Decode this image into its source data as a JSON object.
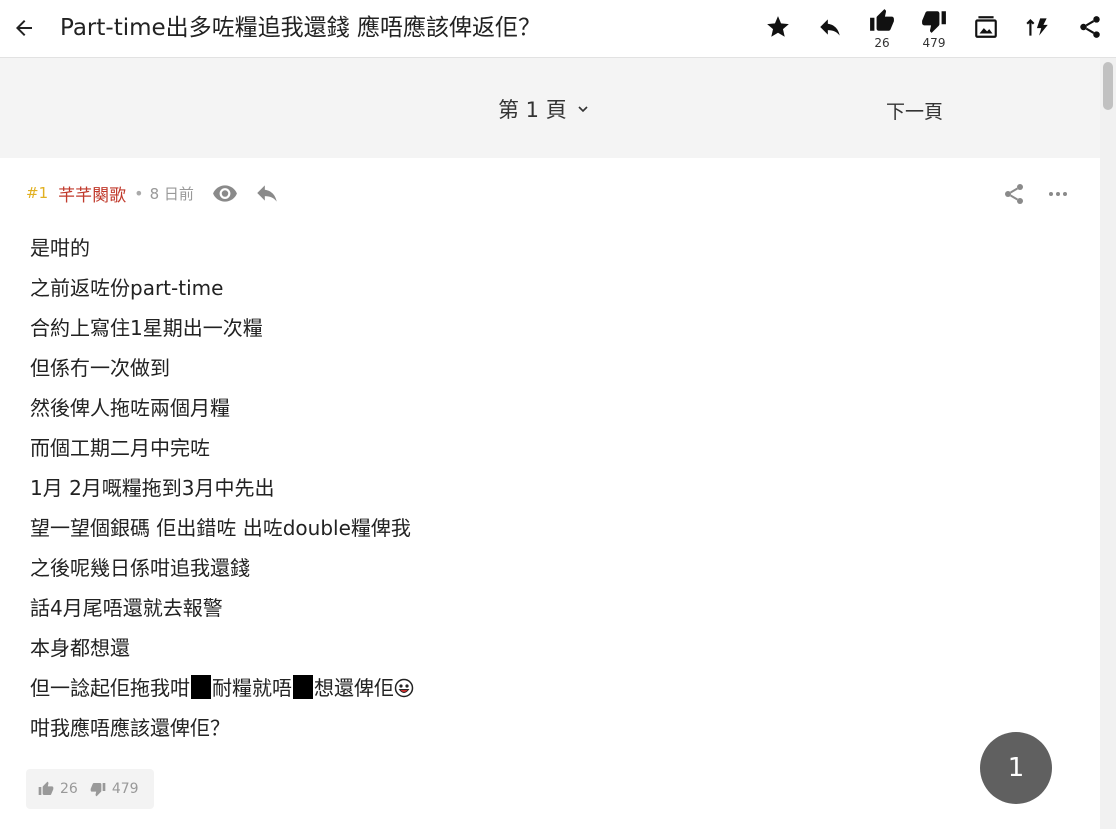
{
  "header": {
    "title": "Part-time出多咗糧追我還錢 應唔應該俾返佢？",
    "like_count": "26",
    "dislike_count": "479"
  },
  "pager": {
    "page_label": "第 1 頁",
    "next_label": "下一頁"
  },
  "post": {
    "number": "#1",
    "author": "芊芊闋歌",
    "separator": "•",
    "time": "8 日前",
    "lines": [
      "是咁的",
      "之前返咗份part-time",
      "合約上寫住1星期出一次糧",
      "但係冇一次做到",
      "然後俾人拖咗兩個月糧",
      "而個工期二月中完咗",
      "1月 2月嘅糧拖到3月中先出",
      "望一望個銀碼 佢出錯咗 出咗double糧俾我",
      "之後呢幾日係咁追我還錢",
      "話4月尾唔還就去報警",
      "本身都想還"
    ],
    "line_12_a": "但一諗起佢拖我咁",
    "line_12_b": "耐糧就唔",
    "line_12_c": "想還俾佢",
    "last_line": "咁我應唔應該還俾佢？",
    "likes": "26",
    "dislikes": "479"
  },
  "fab": {
    "label": "1"
  },
  "colors": {
    "author": "#c0392b",
    "post_number": "#e1b021",
    "fab": "#606060",
    "pager_bg": "#f4f4f4"
  }
}
